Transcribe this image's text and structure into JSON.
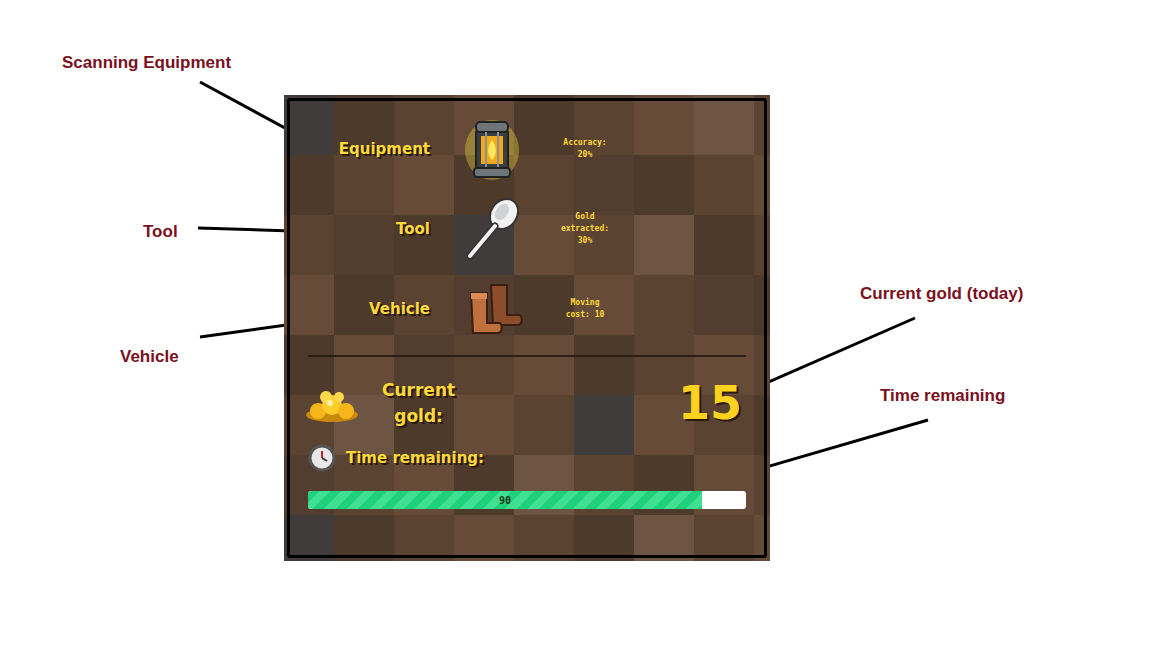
{
  "annotations": [
    {
      "label": "Scanning Equipment"
    },
    {
      "label": "Tool"
    },
    {
      "label": "Vehicle"
    },
    {
      "label": "Current gold (today)"
    },
    {
      "label": "Time remaining"
    }
  ],
  "items": [
    {
      "label": "Equipment",
      "stat": [
        "Accuracy:",
        "20%"
      ]
    },
    {
      "label": "Tool",
      "stat": [
        "Gold",
        "extracted:",
        "30%"
      ]
    },
    {
      "label": "Vehicle",
      "stat": [
        "Moving",
        "cost: 10"
      ]
    }
  ],
  "gold": {
    "label": [
      "Current",
      "gold:"
    ],
    "value": "15"
  },
  "time": {
    "label": "Time remaining:",
    "level": 0.9,
    "reading": "90"
  }
}
